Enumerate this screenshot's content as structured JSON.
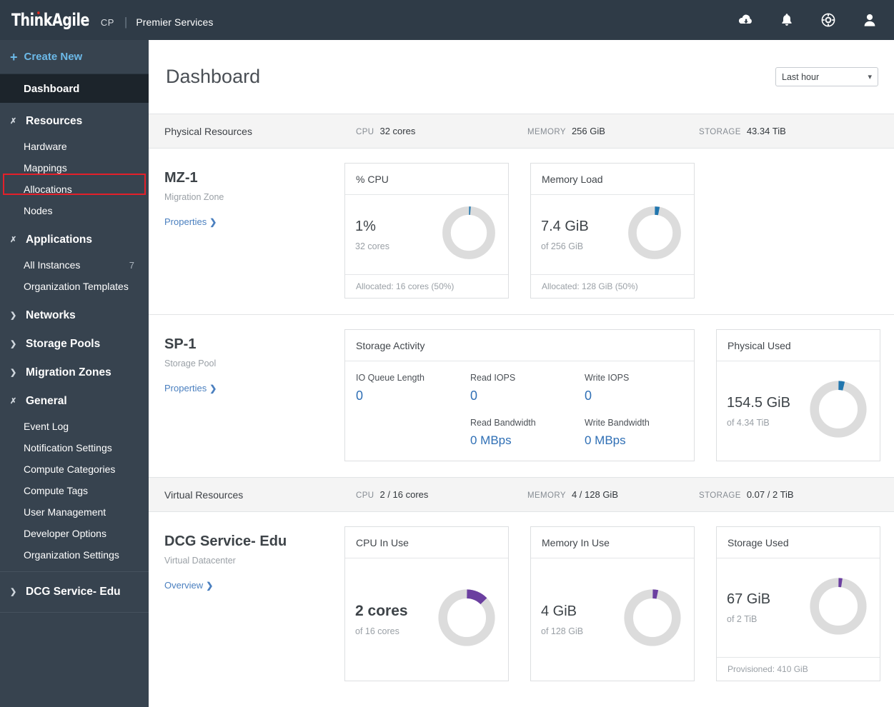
{
  "header": {
    "logo_main": "ThinkAgile",
    "logo_suffix": "CP",
    "logo_separator": "|",
    "product": "Premier Services",
    "icons": [
      "cloud-download-icon",
      "bell-icon",
      "support-icon",
      "user-icon"
    ]
  },
  "sidebar": {
    "create_new": "Create New",
    "dashboard": "Dashboard",
    "groups": [
      {
        "label": "Resources",
        "expanded": true,
        "items": [
          {
            "label": "Hardware",
            "highlighted": true
          },
          {
            "label": "Mappings"
          },
          {
            "label": "Allocations"
          },
          {
            "label": "Nodes"
          }
        ]
      },
      {
        "label": "Applications",
        "expanded": true,
        "items": [
          {
            "label": "All Instances",
            "count": "7"
          },
          {
            "label": "Organization Templates"
          }
        ]
      },
      {
        "label": "Networks",
        "expanded": false,
        "items": []
      },
      {
        "label": "Storage Pools",
        "expanded": false,
        "items": []
      },
      {
        "label": "Migration Zones",
        "expanded": false,
        "items": []
      },
      {
        "label": "General",
        "expanded": true,
        "items": [
          {
            "label": "Event Log"
          },
          {
            "label": "Notification Settings"
          },
          {
            "label": "Compute Categories"
          },
          {
            "label": "Compute Tags"
          },
          {
            "label": "User Management"
          },
          {
            "label": "Developer Options"
          },
          {
            "label": "Organization Settings"
          }
        ]
      },
      {
        "label": "DCG Service- Edu",
        "expanded": false,
        "items": []
      }
    ]
  },
  "page": {
    "title": "Dashboard",
    "time_range": "Last hour"
  },
  "physical": {
    "title": "Physical Resources",
    "cpu_label": "CPU",
    "cpu_value": "32 cores",
    "memory_label": "MEMORY",
    "memory_value": "256 GiB",
    "storage_label": "STORAGE",
    "storage_value": "43.34 TiB"
  },
  "virtual": {
    "title": "Virtual Resources",
    "cpu_label": "CPU",
    "cpu_value": "2 / 16 cores",
    "memory_label": "MEMORY",
    "memory_value": "4 / 128 GiB",
    "storage_label": "STORAGE",
    "storage_value": "0.07 / 2 TiB"
  },
  "mz1": {
    "name": "MZ-1",
    "type": "Migration Zone",
    "link": "Properties",
    "cpu_card": {
      "title": "% CPU",
      "value": "1%",
      "sub": "32 cores",
      "footer": "Allocated: 16 cores (50%)"
    },
    "memory_card": {
      "title": "Memory Load",
      "value": "7.4 GiB",
      "sub": "of 256 GiB",
      "footer": "Allocated: 128 GiB (50%)"
    }
  },
  "sp1": {
    "name": "SP-1",
    "type": "Storage Pool",
    "link": "Properties",
    "activity_card": {
      "title": "Storage Activity",
      "metrics": [
        {
          "label": "IO Queue Length",
          "value": "0"
        },
        {
          "label": "Read IOPS",
          "value": "0"
        },
        {
          "label": "Write IOPS",
          "value": "0"
        },
        {
          "label": "Read Bandwidth",
          "value": "0 MBps"
        },
        {
          "label": "Write Bandwidth",
          "value": "0 MBps"
        }
      ]
    },
    "physical_used_card": {
      "title": "Physical Used",
      "value": "154.5 GiB",
      "sub": "of 4.34 TiB"
    }
  },
  "dcg": {
    "name": "DCG Service- Edu",
    "type": "Virtual Datacenter",
    "link": "Overview",
    "cpu_card": {
      "title": "CPU In Use",
      "value": "2 cores",
      "sub": "of 16 cores"
    },
    "memory_card": {
      "title": "Memory In Use",
      "value": "4 GiB",
      "sub": "of 128 GiB"
    },
    "storage_card": {
      "title": "Storage Used",
      "value": "67 GiB",
      "sub": "of 2 TiB",
      "footer": "Provisioned: 410 GiB"
    }
  },
  "chart_data": [
    {
      "type": "pie",
      "title": "% CPU",
      "values": [
        1,
        99
      ],
      "labels": [
        "used",
        "free"
      ],
      "percent_used": 1,
      "color": "#2176ae"
    },
    {
      "type": "pie",
      "title": "Memory Load",
      "values": [
        7.4,
        248.6
      ],
      "labels": [
        "used",
        "free"
      ],
      "percent_used": 2.9,
      "color": "#2176ae"
    },
    {
      "type": "pie",
      "title": "Physical Used",
      "values": [
        154.5,
        4289.5
      ],
      "labels": [
        "used",
        "free"
      ],
      "percent_used": 3.5,
      "color": "#2176ae"
    },
    {
      "type": "pie",
      "title": "CPU In Use",
      "values": [
        2,
        14
      ],
      "labels": [
        "used",
        "free"
      ],
      "percent_used": 12.5,
      "color": "#6b3fa0"
    },
    {
      "type": "pie",
      "title": "Memory In Use",
      "values": [
        4,
        124
      ],
      "labels": [
        "used",
        "free"
      ],
      "percent_used": 3.1,
      "color": "#6b3fa0"
    },
    {
      "type": "pie",
      "title": "Storage Used",
      "values": [
        67,
        2981
      ],
      "labels": [
        "used",
        "free"
      ],
      "percent_used": 2.2,
      "color": "#6b3fa0"
    }
  ],
  "colors": {
    "sidebar_bg": "#37434f",
    "topbar_bg": "#2f3b47",
    "accent_blue": "#2176ae",
    "accent_purple": "#6b3fa0",
    "highlight_red": "#e4202a",
    "link_blue": "#4a7fbf",
    "donut_track": "#dcdcdc"
  }
}
